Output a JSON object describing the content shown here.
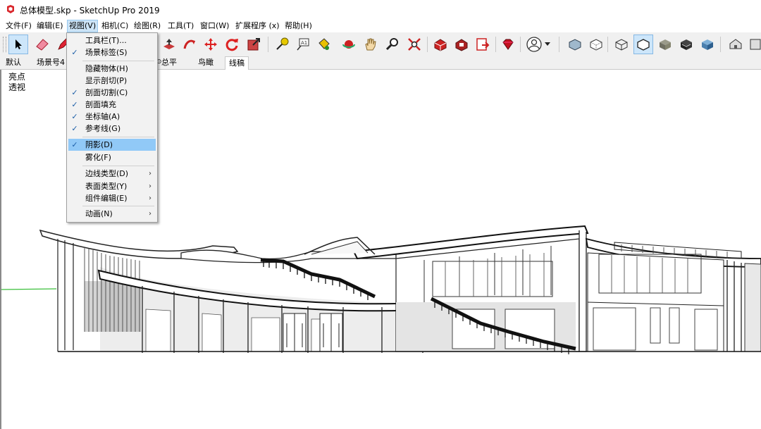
{
  "window": {
    "title": "总体模型.skp - SketchUp Pro 2019",
    "icon": "sketchup-logo-icon"
  },
  "menubar": {
    "items": [
      {
        "label": "文件(F)"
      },
      {
        "label": "编辑(E)"
      },
      {
        "label": "视图(V)"
      },
      {
        "label": "相机(C)"
      },
      {
        "label": "绘图(R)"
      },
      {
        "label": "工具(T)"
      },
      {
        "label": "窗口(W)"
      },
      {
        "label": "扩展程序 (x)"
      },
      {
        "label": "帮助(H)"
      }
    ]
  },
  "toolbar": {
    "icons": [
      "select-arrow-icon",
      "eraser-icon",
      "pencil-icon",
      "push-pull-icon",
      "follow-me-icon",
      "move-icon",
      "rotate-icon",
      "scale-icon",
      "tape-measure-icon",
      "text-label-icon",
      "paint-bucket-icon",
      "orbit-icon",
      "pan-hand-icon",
      "zoom-icon",
      "zoom-extents-icon",
      "warehouse-icon",
      "extension-warehouse-icon",
      "send-to-layout-icon",
      "ruby-extension-icon",
      "account-icon",
      "xray-style-icon",
      "back-edges-style-icon",
      "wireframe-style-icon",
      "hidden-line-style-icon",
      "shaded-style-icon",
      "shaded-textures-style-icon",
      "monochrome-style-icon",
      "iso-view-icon",
      "top-view-icon"
    ]
  },
  "scene_tabs": {
    "items": [
      {
        "label": "默认"
      },
      {
        "label": "场景号4"
      },
      {
        "label": "总平"
      },
      {
        "label": "鸟瞰"
      },
      {
        "label": "线稿"
      }
    ],
    "active": "线稿"
  },
  "viewport": {
    "labels": [
      "亮点",
      "透视"
    ]
  },
  "view_menu": {
    "items": [
      {
        "label": "工具栏(T)...",
        "checked": false,
        "submenu": false
      },
      {
        "label": "场景标签(S)",
        "checked": true,
        "submenu": false
      },
      {
        "label": "隐藏物体(H)",
        "checked": false,
        "submenu": false
      },
      {
        "label": "显示剖切(P)",
        "checked": false,
        "submenu": false
      },
      {
        "label": "剖面切割(C)",
        "checked": true,
        "submenu": false
      },
      {
        "label": "剖面填充",
        "checked": true,
        "submenu": false
      },
      {
        "label": "坐标轴(A)",
        "checked": true,
        "submenu": false
      },
      {
        "label": "参考线(G)",
        "checked": true,
        "submenu": false
      },
      {
        "label": "阴影(D)",
        "checked": true,
        "submenu": false,
        "highlighted": true
      },
      {
        "label": "雾化(F)",
        "checked": false,
        "submenu": false
      },
      {
        "label": "边线类型(D)",
        "checked": false,
        "submenu": true
      },
      {
        "label": "表面类型(Y)",
        "checked": false,
        "submenu": true
      },
      {
        "label": "组件编辑(E)",
        "checked": false,
        "submenu": true
      },
      {
        "label": "动画(N)",
        "checked": false,
        "submenu": true
      }
    ],
    "check_glyph": "✓",
    "submenu_glyph": "›"
  },
  "colors": {
    "menu_highlight": "#91c9f7",
    "toolbar_bg": "#f0f0f0",
    "axis_green": "#3bbf3b",
    "checkmark": "#1c5fa8"
  }
}
